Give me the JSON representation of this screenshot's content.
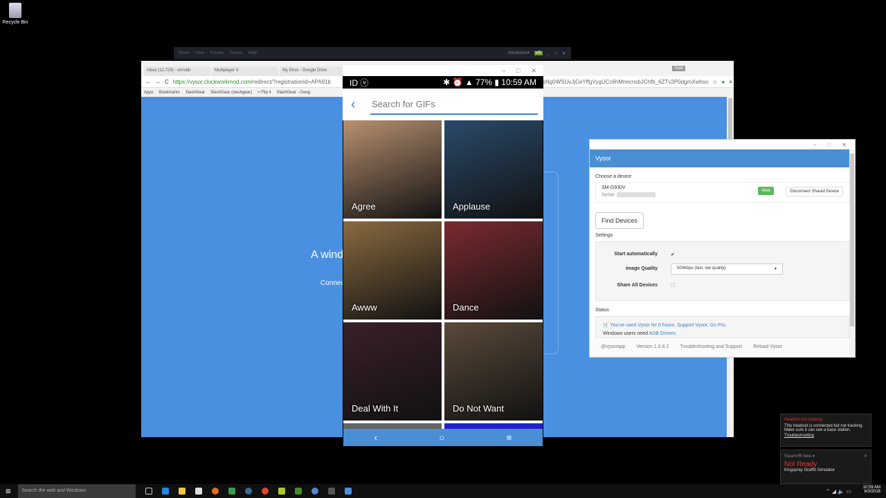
{
  "desktop": {
    "recycle_bin": "Recycle Bin"
  },
  "steam": {
    "menu": [
      "Steam",
      "View",
      "Friends",
      "Games",
      "Help"
    ],
    "user": "chrisburns4",
    "vr_badge": "VR"
  },
  "chrome": {
    "tabs": [
      "Inbox (12,729) - chrisbb",
      "Multiplayer X",
      "My Drive - Google Drive"
    ],
    "profile_badge": "Todd",
    "url_secure": "https://vysor.clockworkmod.com",
    "url_rest": "/redirect/?registrationId=APA91b",
    "url_tail": "sNg0WSUvJjCeYffgVygUCc6hMnecnsbJChfb_6ZTv2P0dgmXwhso",
    "bookmarks": [
      "Apps",
      "Bookmarks",
      "SlashGear",
      "SlashGear (slashgear)",
      "= Flip it",
      "SlashGear - Goog"
    ],
    "page": {
      "headline": "A wind",
      "sub": "Connec"
    }
  },
  "phone": {
    "status": {
      "battery": "77%",
      "time": "10:59 AM"
    },
    "search_placeholder": "Search for GIFs",
    "tiles": [
      {
        "label": "Agree",
        "color": "#b89070"
      },
      {
        "label": "Applause",
        "color": "#2a4a6a"
      },
      {
        "label": "Awww",
        "color": "#8a6a40"
      },
      {
        "label": "Dance",
        "color": "#7a2a30"
      },
      {
        "label": "Deal With It",
        "color": "#3a2028"
      },
      {
        "label": "Do Not Want",
        "color": "#5a4a3a"
      }
    ],
    "nav": {
      "back": "‹",
      "home": "○",
      "menu": "≡"
    }
  },
  "vysor": {
    "title": "Vysor",
    "choose_label": "Choose a device",
    "device": {
      "model": "SM-G930V",
      "serial_label": "Serial:"
    },
    "view_btn": "View",
    "disconnect_btn": "Disconnect Shared Device",
    "find_btn": "Find Devices",
    "settings_label": "Settings",
    "settings": {
      "start_auto": "Start automatically",
      "start_auto_checked": true,
      "image_quality": "Image Quality",
      "image_quality_value": "500Kbps (fast, low quality)",
      "share_all": "Share All Devices",
      "share_all_checked": false
    },
    "status_label": "Status",
    "status_line": "You've used Vysor for 0 hours. Support Vysor. Go Pro.",
    "drivers_prefix": "Windows users need ",
    "drivers_link": "ADB Drivers",
    "footer": [
      "@vysorapp",
      "Version 1.0.8.2",
      "Troubleshooting and Support",
      "Reload Vysor"
    ]
  },
  "steamvr": {
    "alert_title": "Headset not tracking",
    "alert_body": "This headset is connected but not tracking. Make sure it can see a base station.",
    "alert_link": "Troubleshooting",
    "panel_title": "SteamVR beta ▾",
    "state": "Not Ready",
    "game": "Kingspray Graffiti Simulator"
  },
  "taskbar": {
    "search": "Search the web and Windows",
    "time": "10:59 AM",
    "date": "6/3/2016"
  }
}
